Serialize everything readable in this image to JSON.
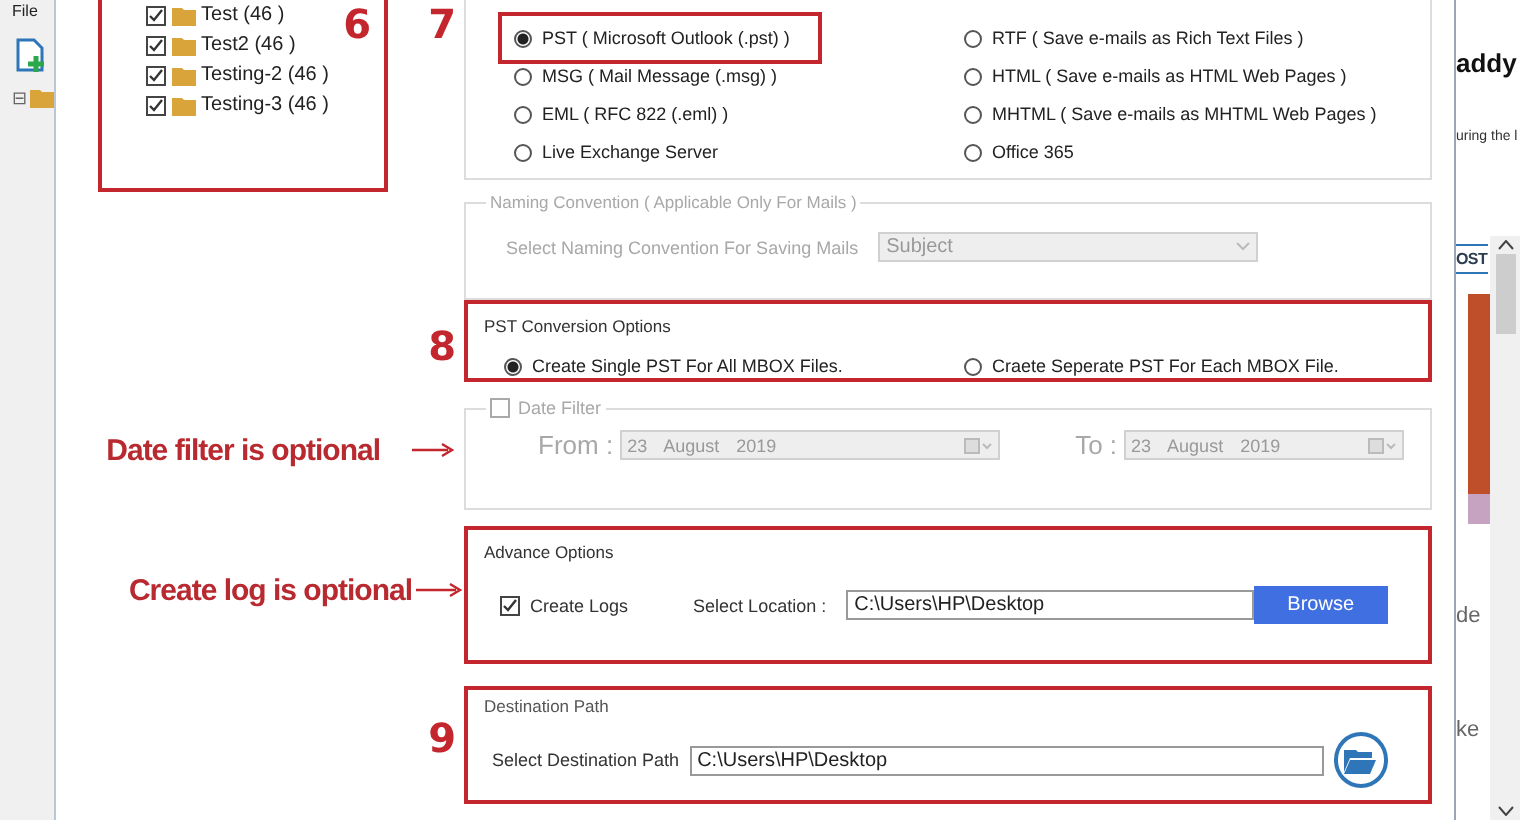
{
  "background_window": {
    "menu": "File",
    "tree_toggle": "⊟"
  },
  "tree": {
    "items": [
      {
        "label": "Test (46 )",
        "checked": true
      },
      {
        "label": "Test2 (46 )",
        "checked": true
      },
      {
        "label": "Testing-2 (46 )",
        "checked": true
      },
      {
        "label": "Testing-3 (46 )",
        "checked": true
      }
    ]
  },
  "annotations": {
    "tree_step": "6",
    "format_step": "7",
    "pst_step": "8",
    "date_note": "Date filter is optional",
    "log_note": "Create log is optional",
    "destination_step": "9"
  },
  "output_formats": [
    {
      "label": "PST ( Microsoft Outlook (.pst) )",
      "selected": true,
      "highlighted": true
    },
    {
      "label": "RTF ( Save e-mails as Rich Text Files )",
      "selected": false,
      "highlighted": false
    },
    {
      "label": "MSG ( Mail Message (.msg) )",
      "selected": false,
      "highlighted": false
    },
    {
      "label": "HTML ( Save e-mails as HTML Web Pages )",
      "selected": false,
      "highlighted": false
    },
    {
      "label": "EML ( RFC 822 (.eml) )",
      "selected": false,
      "highlighted": false
    },
    {
      "label": "MHTML ( Save e-mails as MHTML Web Pages )",
      "selected": false,
      "highlighted": false
    },
    {
      "label": "Live Exchange Server",
      "selected": false,
      "highlighted": false
    },
    {
      "label": "Office 365",
      "selected": false,
      "highlighted": false
    }
  ],
  "naming_convention": {
    "legend": "Naming Convention ( Applicable Only For Mails )",
    "label": "Select Naming Convention For Saving Mails",
    "value": "Subject",
    "disabled": true
  },
  "pst_conversion": {
    "legend": "PST Conversion Options",
    "highlighted": true,
    "options": [
      {
        "label": "Create Single PST For All MBOX Files.",
        "selected": true
      },
      {
        "label": "Craete Seperate PST  For Each MBOX File.",
        "selected": false
      }
    ]
  },
  "date_filter": {
    "label": "Date Filter",
    "checked": false,
    "disabled": true,
    "from_label": "From :",
    "from_value": "23 August 2019",
    "to_label": "To :",
    "to_value": "23 August 2019"
  },
  "advance_options": {
    "legend": "Advance Options",
    "highlighted": true,
    "create_logs": {
      "label": "Create Logs",
      "checked": true
    },
    "location_label": "Select Location :",
    "location_value": "C:\\Users\\HP\\Desktop",
    "button": "Browse"
  },
  "destination": {
    "legend": "Destination Path",
    "highlighted": true,
    "label": "Select Destination Path",
    "value": "C:\\Users\\HP\\Desktop"
  },
  "side_page": {
    "heading": "addy",
    "line": "uring the l",
    "tab": "OST",
    "text_1": "de",
    "text_2": "ke"
  }
}
